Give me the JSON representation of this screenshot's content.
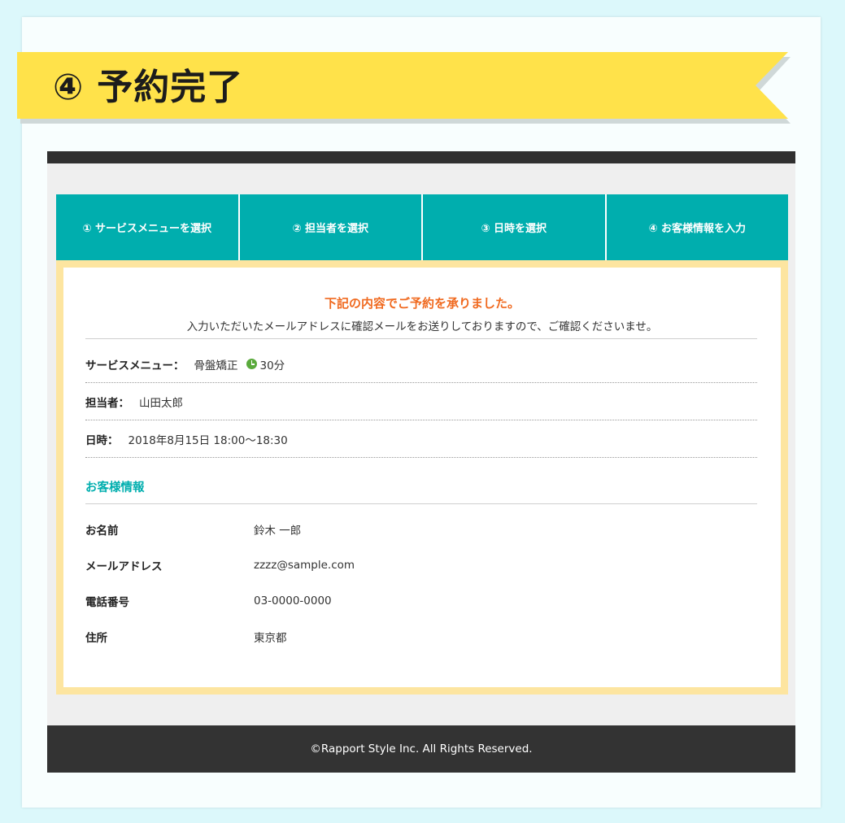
{
  "page": {
    "title_number": "④",
    "title": "予約完了"
  },
  "steps": [
    {
      "label": "① サービスメニューを選択"
    },
    {
      "label": "② 担当者を選択"
    },
    {
      "label": "③ 日時を選択"
    },
    {
      "label": "④ お客様情報を入力"
    }
  ],
  "confirmation": {
    "heading": "下記の内容でご予約を承りました。",
    "message": "入力いただいたメールアドレスに確認メールをお送りしておりますので、ご確認くださいませ。"
  },
  "reservation": {
    "service_label": "サービスメニュー：",
    "service_value": "骨盤矯正",
    "duration_icon": "clock-icon",
    "duration": "30分",
    "staff_label": "担当者：",
    "staff_value": "山田太郎",
    "datetime_label": "日時：",
    "datetime_value": "2018年8月15日 18:00〜18:30"
  },
  "customer": {
    "section_title": "お客様情報",
    "fields": [
      {
        "label": "お名前",
        "value": "鈴木 一郎"
      },
      {
        "label": "メールアドレス",
        "value": "zzzz@sample.com"
      },
      {
        "label": "電話番号",
        "value": "03-0000-0000"
      },
      {
        "label": "住所",
        "value": "東京都"
      }
    ]
  },
  "footer": {
    "copyright": "©Rapport Style Inc. All Rights Reserved."
  },
  "colors": {
    "background": "#dcf8fb",
    "ribbon": "#ffe24a",
    "accent": "#00aeae",
    "notice": "#f06a20",
    "panel_border": "#fde5a0",
    "dark": "#333333"
  }
}
